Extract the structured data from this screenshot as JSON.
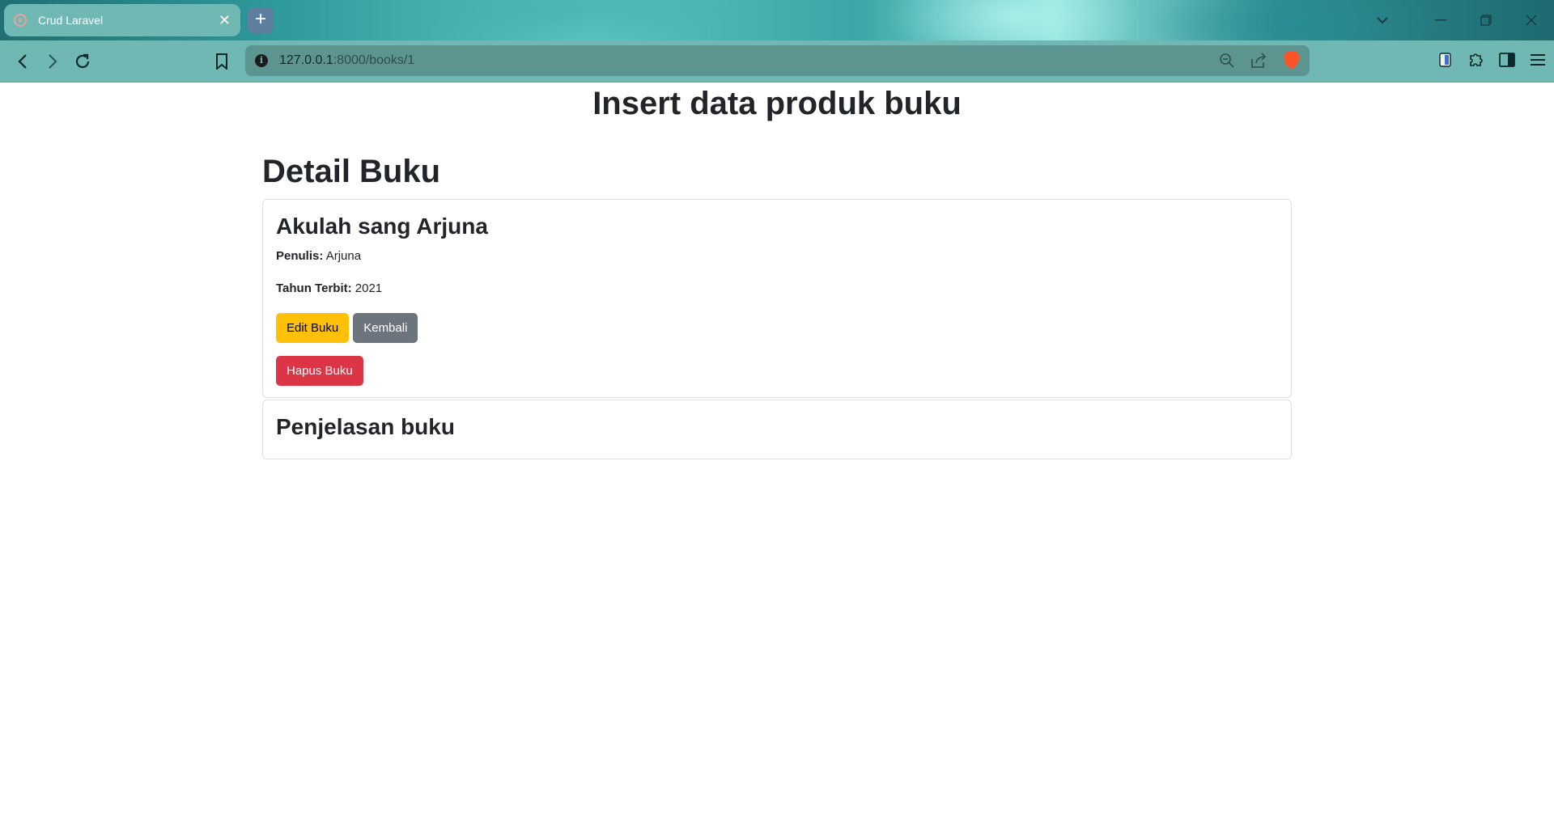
{
  "browser": {
    "tab": {
      "title": "Crud Laravel",
      "close": "✕"
    },
    "new_tab": "+",
    "url_host": "127.0.0.1",
    "url_rest": ":8000/books/1"
  },
  "page": {
    "title": "Insert data produk buku",
    "section_title": "Detail Buku",
    "book": {
      "title": "Akulah sang Arjuna",
      "author_label": "Penulis:",
      "author": "Arjuna",
      "year_label": "Tahun Terbit:",
      "year": "2021"
    },
    "buttons": {
      "edit": "Edit Buku",
      "back": "Kembali",
      "delete": "Hapus Buku"
    },
    "description_title": "Penjelasan buku"
  },
  "colors": {
    "warning": "#ffc107",
    "secondary": "#6c757d",
    "danger": "#dc3545",
    "chrome": "#6fb8b3"
  }
}
